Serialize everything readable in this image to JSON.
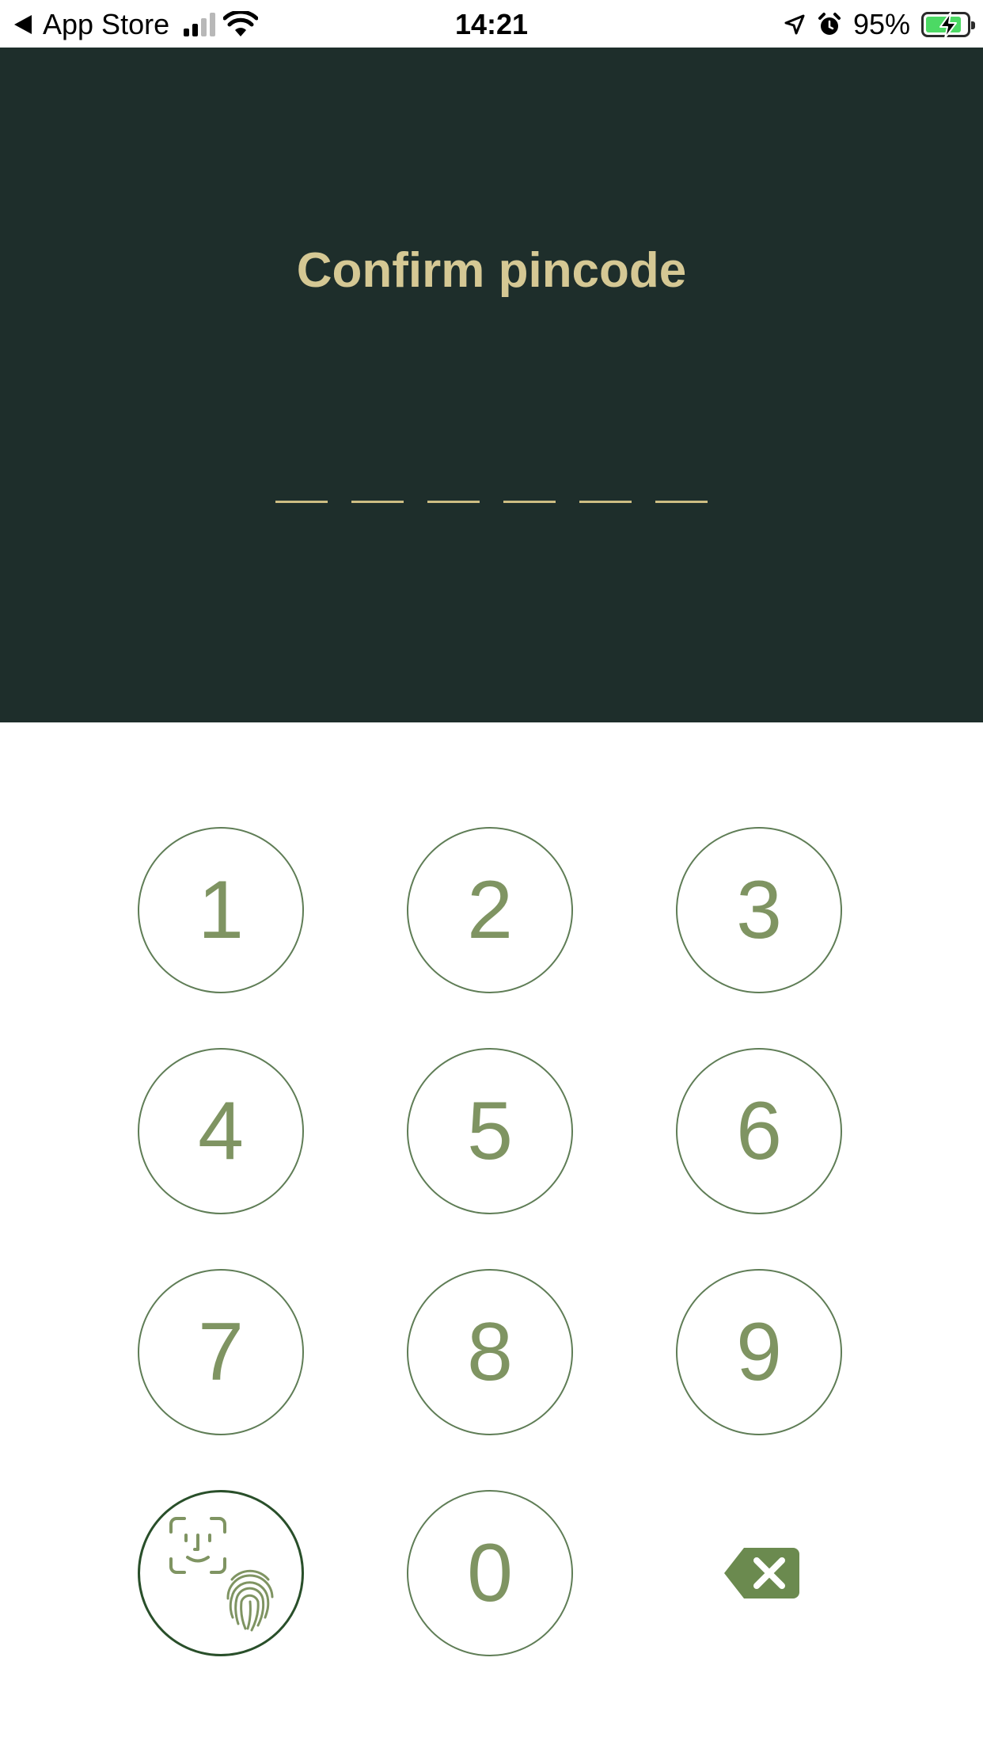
{
  "status_bar": {
    "back_app": "App Store",
    "time": "14:21",
    "battery_percent": "95%",
    "signal_bars_active": 2,
    "signal_bars_total": 4,
    "battery_level": 0.95,
    "icons": [
      "back-arrow-icon",
      "cellular-signal-icon",
      "wifi-icon",
      "location-arrow-icon",
      "alarm-clock-icon",
      "battery-charging-icon"
    ]
  },
  "header": {
    "title": "Confirm pincode",
    "pin_length": 6,
    "pin_entered": 0
  },
  "keypad": {
    "keys": [
      "1",
      "2",
      "3",
      "4",
      "5",
      "6",
      "7",
      "8",
      "9",
      "0"
    ],
    "biometric_icon": "faceid-fingerprint-icon",
    "delete_icon": "backspace-icon"
  },
  "colors": {
    "header_background": "#1e2e2b",
    "title": "#d5c894",
    "pin_dash": "#cdbd83",
    "key_border": "#5f7d56",
    "key_digit": "#7f9462",
    "backspace": "#6b8a4f",
    "battery_fill": "#4cd964"
  }
}
